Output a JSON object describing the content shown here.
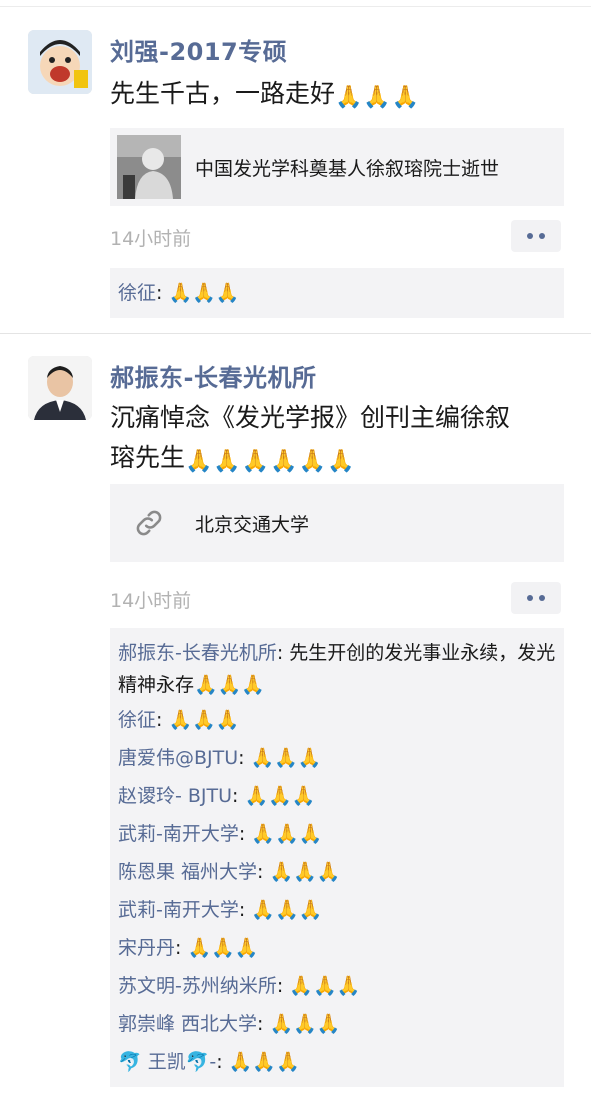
{
  "colors": {
    "name": "#576b95",
    "time": "#b2b2b2",
    "card_bg": "#f3f3f5"
  },
  "posts": [
    {
      "author": "刘强-2017专硕",
      "text": "先生千古，一路走好",
      "emoji": "🙏",
      "emoji_count": 3,
      "link": {
        "title": "中国发光学科奠基人徐叙瑢院士逝世",
        "thumb_icon": "portrait-photo"
      },
      "time": "14小时前",
      "comments": [
        {
          "name": "徐征",
          "text": ": 🙏🙏🙏"
        }
      ]
    },
    {
      "author": "郝振东-长春光机所",
      "text_line1": "沉痛悼念《发光学报》创刊主编徐叙",
      "text_line2": "瑢先生",
      "emoji": "🙏",
      "emoji_count": 6,
      "link": {
        "title": "北京交通大学",
        "thumb_icon": "link-icon"
      },
      "time": "14小时前",
      "comments": [
        {
          "name": "郝振东-长春光机所",
          "text": ": 先生开创的发光事业永续，发光精神永存🙏🙏🙏"
        },
        {
          "name": "徐征",
          "text": ": 🙏🙏🙏"
        },
        {
          "name": "唐爱伟@BJTU",
          "text": ": 🙏🙏🙏"
        },
        {
          "name": "赵谡玲- BJTU",
          "text": ": 🙏🙏🙏"
        },
        {
          "name": "武莉-南开大学",
          "text": ": 🙏🙏🙏"
        },
        {
          "name": "陈恩果 福州大学",
          "text": ": 🙏🙏🙏"
        },
        {
          "name": "武莉-南开大学",
          "text": ": 🙏🙏🙏"
        },
        {
          "name": "宋丹丹",
          "text": ": 🙏🙏🙏"
        },
        {
          "name": "苏文明-苏州纳米所",
          "text": ": 🙏🙏🙏"
        },
        {
          "name": "郭崇峰 西北大学",
          "text": ": 🙏🙏🙏"
        },
        {
          "name": "🐬 王凯🐬-",
          "text": ": 🙏🙏🙏"
        }
      ]
    }
  ]
}
